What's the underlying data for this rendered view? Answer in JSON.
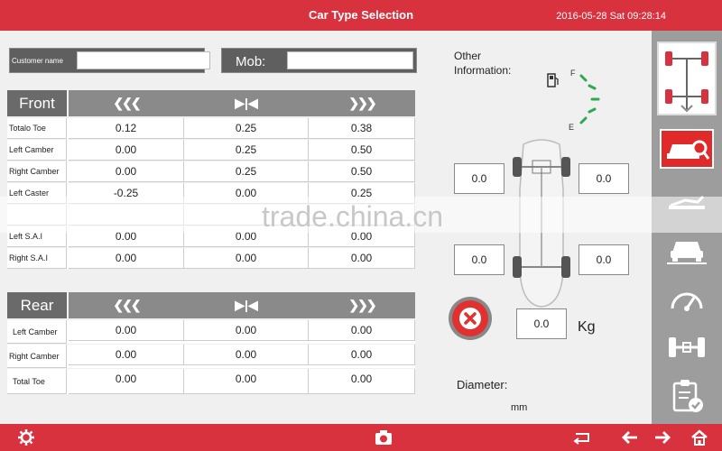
{
  "header": {
    "title": "Car Type Selection",
    "datetime": "2016-05-28 Sat 09:28:14"
  },
  "customer": {
    "label": "Customer name",
    "value": ""
  },
  "mob": {
    "label": "Mob:",
    "value": ""
  },
  "front": {
    "title": "Front",
    "columns": [
      "❮❮❮",
      "▶|◀",
      "❯❯❯"
    ],
    "rows": [
      {
        "label": "Totalo Toe",
        "values": [
          "0.12",
          "0.25",
          "0.38"
        ]
      },
      {
        "label": "Left Camber",
        "values": [
          "0.00",
          "0.25",
          "0.50"
        ]
      },
      {
        "label": "Right Camber",
        "values": [
          "0.00",
          "0.25",
          "0.50"
        ]
      },
      {
        "label": "Left Caster",
        "values": [
          "-0.25",
          "0.00",
          "0.25"
        ]
      },
      {
        "label": "",
        "values": [
          "",
          "",
          ""
        ]
      },
      {
        "label": "Left S.A.I",
        "values": [
          "0.00",
          "0.00",
          "0.00"
        ]
      },
      {
        "label": "Right S.A.I",
        "values": [
          "0.00",
          "0.00",
          "0.00"
        ]
      }
    ]
  },
  "rear": {
    "title": "Rear",
    "columns": [
      "❮❮❮",
      "▶|◀",
      "❯❯❯"
    ],
    "rows": [
      {
        "label": "Left Camber",
        "values": [
          "0.00",
          "0.00",
          "0.00"
        ]
      },
      {
        "label": "Right Camber",
        "values": [
          "0.00",
          "0.00",
          "0.00"
        ]
      },
      {
        "label": "Total Toe",
        "values": [
          "0.00",
          "0.00",
          "0.00"
        ]
      }
    ]
  },
  "other_info": {
    "line1": "Other",
    "line2": "Information:"
  },
  "fuel_gauge": {
    "full_label": "F",
    "empty_label": "E"
  },
  "wheels": {
    "front_left": "0.0",
    "front_right": "0.0",
    "rear_left": "0.0",
    "rear_right": "0.0"
  },
  "weight": {
    "value": "0.0",
    "unit": "Kg"
  },
  "diameter": {
    "label": "Diameter:",
    "unit": "mm"
  },
  "watermark": "trade.china.cn",
  "colors": {
    "accent": "#d8323f",
    "sidebar": "#9d9d9d",
    "header_cell": "#8a8a8a"
  }
}
